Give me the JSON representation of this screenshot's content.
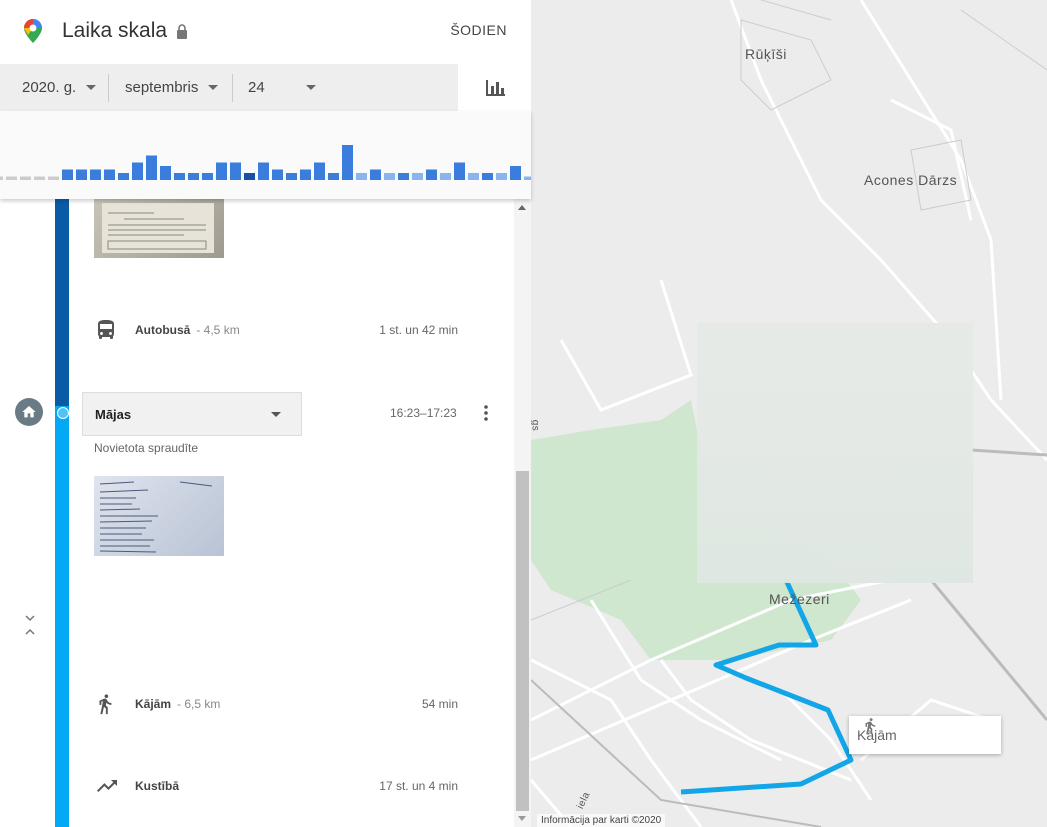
{
  "header": {
    "title": "Laika skala",
    "today_label": "ŠODIEN"
  },
  "selectors": {
    "year": "2020. g.",
    "month": "septembris",
    "day": "24"
  },
  "histogram": {
    "values": [
      1,
      1,
      1,
      1,
      1,
      3,
      3,
      3,
      3,
      2,
      5,
      7,
      4,
      2,
      2,
      2,
      5,
      5,
      2,
      5,
      3,
      2,
      3,
      5,
      2,
      10,
      2,
      3,
      2,
      2,
      2,
      3,
      2,
      5,
      2,
      2,
      2,
      4,
      1
    ],
    "selected_index": 18,
    "colors": {
      "default": "#3b7ddd",
      "light": "#8ab4f0",
      "selected": "#1a4fa8",
      "empty": "#cccccc"
    }
  },
  "segments": {
    "bus": {
      "label": "Autobusā",
      "distance": "- 4,5 km",
      "duration": "1 st. un 42 min"
    },
    "place": {
      "name": "Mājas",
      "time": "16:23–17:23",
      "note": "Novietota spraudīte"
    },
    "walk": {
      "label": "Kājām",
      "distance": "- 6,5 km",
      "duration": "54 min"
    },
    "moving": {
      "label": "Kustībā",
      "duration": "17 st. un 4 min"
    }
  },
  "map": {
    "labels": {
      "rukisi": "Rūķīši",
      "acones": "Acones Dārzs",
      "mezezeri": "Mežezeri",
      "street": "iela",
      "side": "gs"
    },
    "walk_tooltip": "Kājām",
    "attribution": "Informācija par karti ©2020",
    "route_color": "#12a6e8"
  }
}
